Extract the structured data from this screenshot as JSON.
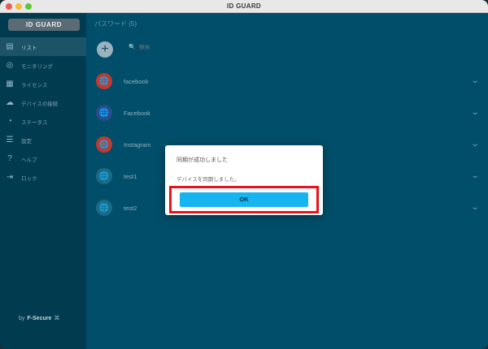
{
  "window": {
    "title": "ID GUARD"
  },
  "sidebar": {
    "logo": "ID GUARD",
    "items": [
      {
        "label": "リスト",
        "icon": "list-icon",
        "active": true
      },
      {
        "label": "モニタリング",
        "icon": "monitoring-icon",
        "active": false
      },
      {
        "label": "ライセンス",
        "icon": "license-icon",
        "active": false
      },
      {
        "label": "デバイスの接続",
        "icon": "cloud-upload-icon",
        "active": false
      },
      {
        "label": "ステータス",
        "icon": "status-icon",
        "active": false
      },
      {
        "label": "設定",
        "icon": "sliders-icon",
        "active": false
      },
      {
        "label": "ヘルプ",
        "icon": "help-icon",
        "active": false
      },
      {
        "label": "ロック",
        "icon": "lock-icon",
        "active": false
      }
    ],
    "footer_by": "by",
    "footer_brand": "F-Secure"
  },
  "main": {
    "title": "パスワード",
    "count": "(5)",
    "search_placeholder": "検索",
    "entries": [
      {
        "name": "facebook",
        "icon_color": "#c3392e"
      },
      {
        "name": "Facebook",
        "icon_color": "#2b4b8c"
      },
      {
        "name": "Instagram",
        "icon_color": "#c3392e"
      },
      {
        "name": "test1",
        "icon_color": "#1d6a85"
      },
      {
        "name": "test2",
        "icon_color": "#1d6a85"
      }
    ]
  },
  "dialog": {
    "title": "同期が成功しました",
    "message": "デバイスを同期しました。",
    "ok_label": "OK",
    "highlight_color": "#e8141c",
    "button_color": "#17b5ef"
  }
}
